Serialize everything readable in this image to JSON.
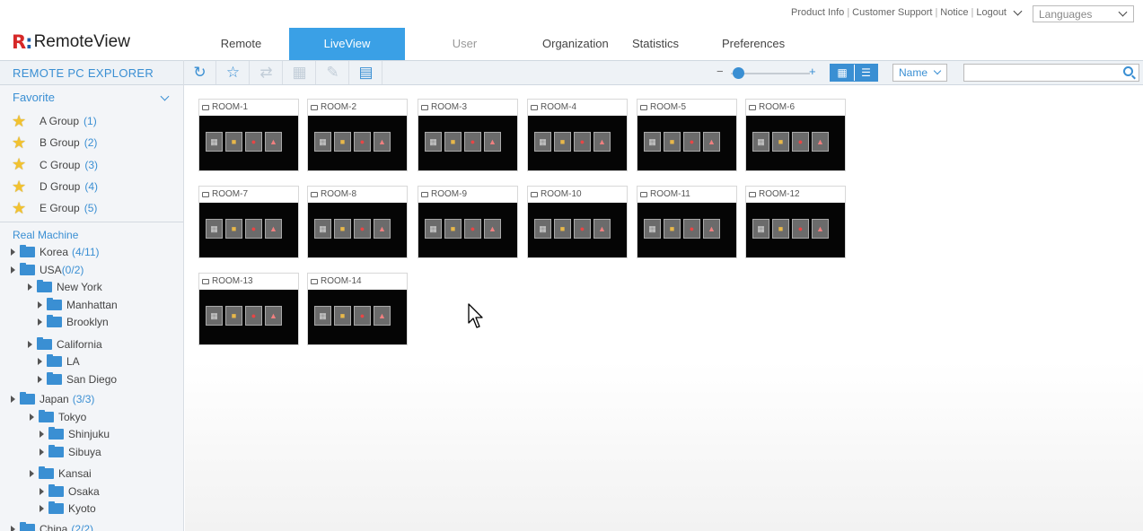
{
  "header": {
    "logo_text": "RemoteView",
    "top_links": [
      "Product Info",
      "Customer Support",
      "Notice",
      "Logout"
    ],
    "languages_label": "Languages",
    "tabs": [
      {
        "label": "Remote PC",
        "state": "normal"
      },
      {
        "label": "LiveView",
        "state": "active"
      },
      {
        "label": "User Management",
        "state": "muted"
      },
      {
        "label": "Organization",
        "state": "normal"
      },
      {
        "label": "Statistics",
        "state": "normal"
      },
      {
        "label": "Preferences",
        "state": "normal"
      }
    ]
  },
  "sidebar": {
    "title": "REMOTE PC EXPLORER",
    "favorite_label": "Favorite",
    "favorites": [
      {
        "name": "A Group",
        "count": "(1)"
      },
      {
        "name": "B Group",
        "count": "(2)"
      },
      {
        "name": "C Group",
        "count": "(3)"
      },
      {
        "name": "D Group",
        "count": "(4)"
      },
      {
        "name": "E Group",
        "count": "(5)"
      }
    ],
    "real_machine_label": "Real Machine",
    "tree": [
      {
        "name": "Korea",
        "count": "(4/11)"
      },
      {
        "name": "USA",
        "count": "(0/2)"
      },
      {
        "name": "New York",
        "count": ""
      },
      {
        "name": "Manhattan",
        "count": ""
      },
      {
        "name": "Brooklyn",
        "count": ""
      },
      {
        "name": "California",
        "count": ""
      },
      {
        "name": "LA",
        "count": ""
      },
      {
        "name": "San Diego",
        "count": ""
      },
      {
        "name": "Japan",
        "count": "(3/3)"
      },
      {
        "name": "Tokyo",
        "count": ""
      },
      {
        "name": "Shinjuku",
        "count": ""
      },
      {
        "name": "Sibuya",
        "count": ""
      },
      {
        "name": "Kansai",
        "count": ""
      },
      {
        "name": "Osaka",
        "count": ""
      },
      {
        "name": "Kyoto",
        "count": ""
      },
      {
        "name": "China",
        "count": "(2/2)"
      }
    ]
  },
  "toolbar": {
    "zoom_level": 0.05,
    "sort_value": "Name",
    "search_placeholder": "",
    "icons": [
      "refresh-icon",
      "star-add-icon",
      "swap-icon",
      "delete-icon",
      "edit-icon",
      "notes-icon"
    ]
  },
  "rooms": [
    {
      "name": "ROOM-1"
    },
    {
      "name": "ROOM-2"
    },
    {
      "name": "ROOM-3"
    },
    {
      "name": "ROOM-4"
    },
    {
      "name": "ROOM-5"
    },
    {
      "name": "ROOM-6"
    },
    {
      "name": "ROOM-7"
    },
    {
      "name": "ROOM-8"
    },
    {
      "name": "ROOM-9"
    },
    {
      "name": "ROOM-10"
    },
    {
      "name": "ROOM-11"
    },
    {
      "name": "ROOM-12"
    },
    {
      "name": "ROOM-13"
    },
    {
      "name": "ROOM-14"
    }
  ],
  "colors": {
    "accent": "#3aa0e6",
    "brand_red": "#d62828",
    "star": "#f2c230"
  }
}
